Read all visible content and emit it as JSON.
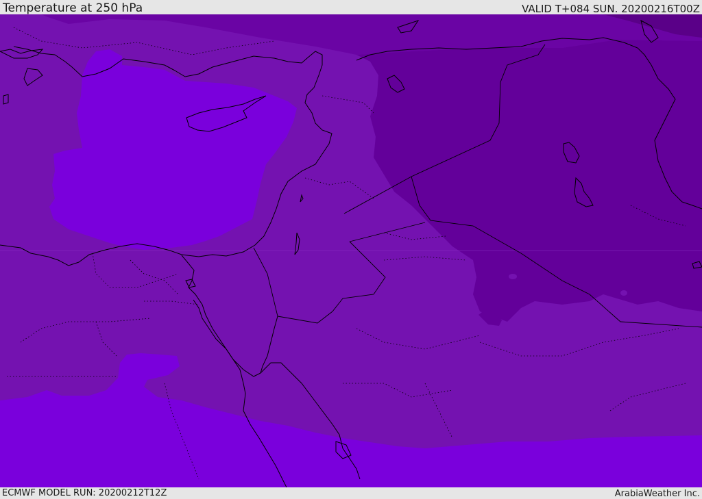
{
  "header": {
    "title": "Temperature at 250 hPa",
    "valid": "VALID T+084 SUN. 20200216T00Z"
  },
  "footer": {
    "model_run": "ECMWF MODEL RUN: 20200212T12Z",
    "credit": "ArabiaWeather Inc."
  },
  "map": {
    "colors": {
      "mid_band": "#7412b0",
      "warm_band": "#7a00dc",
      "cold_band": "#63009a",
      "coldest_band": "#5a0088",
      "coastline": "#000000"
    }
  }
}
